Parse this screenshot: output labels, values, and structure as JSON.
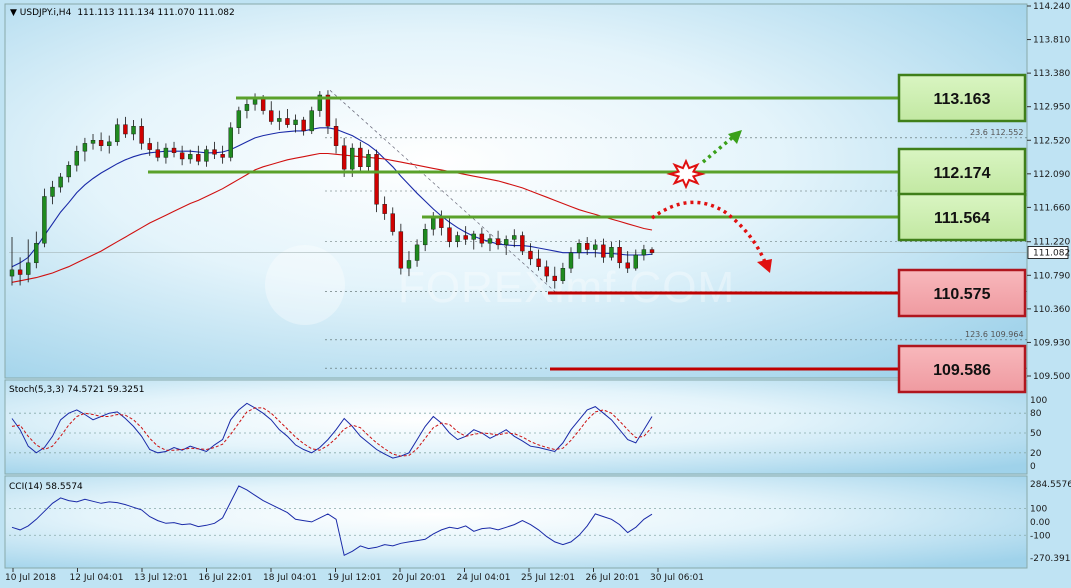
{
  "header": {
    "symbol": "USDJPY.i,H4",
    "ohlc": "111.113 111.134 111.070 111.082"
  },
  "watermark": "FOREXimf.COM",
  "colors": {
    "background": "#bfe3f3",
    "bull_candle": "#1f8a1f",
    "bear_candle": "#d00000",
    "ma_fast": "#1a2aa8",
    "ma_slow": "#d01010",
    "support_line": "#c00000",
    "resistance_line": "#5aa12a",
    "resistance_box": "#cdeeb0",
    "support_box": "#f4a3a8"
  },
  "chart_data": [
    {
      "type": "candlestick",
      "panel": "price",
      "ylim": [
        109.5,
        114.24
      ],
      "y_ticks": [
        "114.240",
        "113.810",
        "113.380",
        "112.950",
        "112.520",
        "112.090",
        "111.660",
        "111.220",
        "110.790",
        "110.360",
        "109.930",
        "109.500"
      ],
      "current_price": "111.082",
      "x_ticks": [
        "10 Jul 2018",
        "12 Jul 04:01",
        "13 Jul 12:01",
        "16 Jul 22:01",
        "18 Jul 04:01",
        "19 Jul 12:01",
        "20 Jul 20:01",
        "24 Jul 04:01",
        "25 Jul 12:01",
        "26 Jul 20:01",
        "30 Jul 06:01"
      ],
      "candles": [
        {
          "o": 110.78,
          "h": 111.28,
          "l": 110.66,
          "c": 110.86
        },
        {
          "o": 110.86,
          "h": 111.02,
          "l": 110.66,
          "c": 110.8
        },
        {
          "o": 110.8,
          "h": 111.25,
          "l": 110.7,
          "c": 110.95
        },
        {
          "o": 110.95,
          "h": 111.35,
          "l": 110.88,
          "c": 111.2
        },
        {
          "o": 111.2,
          "h": 111.9,
          "l": 111.15,
          "c": 111.8
        },
        {
          "o": 111.8,
          "h": 112.0,
          "l": 111.7,
          "c": 111.92
        },
        {
          "o": 111.92,
          "h": 112.1,
          "l": 111.85,
          "c": 112.05
        },
        {
          "o": 112.05,
          "h": 112.25,
          "l": 111.98,
          "c": 112.2
        },
        {
          "o": 112.2,
          "h": 112.45,
          "l": 112.12,
          "c": 112.38
        },
        {
          "o": 112.38,
          "h": 112.55,
          "l": 112.25,
          "c": 112.48
        },
        {
          "o": 112.48,
          "h": 112.6,
          "l": 112.4,
          "c": 112.52
        },
        {
          "o": 112.52,
          "h": 112.62,
          "l": 112.38,
          "c": 112.45
        },
        {
          "o": 112.45,
          "h": 112.58,
          "l": 112.35,
          "c": 112.5
        },
        {
          "o": 112.5,
          "h": 112.8,
          "l": 112.45,
          "c": 112.72
        },
        {
          "o": 112.72,
          "h": 112.82,
          "l": 112.55,
          "c": 112.6
        },
        {
          "o": 112.6,
          "h": 112.78,
          "l": 112.52,
          "c": 112.7
        },
        {
          "o": 112.7,
          "h": 112.8,
          "l": 112.4,
          "c": 112.48
        },
        {
          "o": 112.48,
          "h": 112.55,
          "l": 112.32,
          "c": 112.4
        },
        {
          "o": 112.4,
          "h": 112.5,
          "l": 112.25,
          "c": 112.3
        },
        {
          "o": 112.3,
          "h": 112.48,
          "l": 112.22,
          "c": 112.42
        },
        {
          "o": 112.42,
          "h": 112.5,
          "l": 112.3,
          "c": 112.36
        },
        {
          "o": 112.36,
          "h": 112.45,
          "l": 112.2,
          "c": 112.28
        },
        {
          "o": 112.28,
          "h": 112.4,
          "l": 112.22,
          "c": 112.34
        },
        {
          "o": 112.34,
          "h": 112.45,
          "l": 112.2,
          "c": 112.25
        },
        {
          "o": 112.25,
          "h": 112.45,
          "l": 112.18,
          "c": 112.4
        },
        {
          "o": 112.4,
          "h": 112.5,
          "l": 112.28,
          "c": 112.34
        },
        {
          "o": 112.34,
          "h": 112.45,
          "l": 112.22,
          "c": 112.3
        },
        {
          "o": 112.3,
          "h": 112.75,
          "l": 112.25,
          "c": 112.68
        },
        {
          "o": 112.68,
          "h": 112.95,
          "l": 112.6,
          "c": 112.9
        },
        {
          "o": 112.9,
          "h": 113.05,
          "l": 112.8,
          "c": 112.98
        },
        {
          "o": 112.98,
          "h": 113.12,
          "l": 112.9,
          "c": 113.05
        },
        {
          "o": 113.05,
          "h": 113.1,
          "l": 112.85,
          "c": 112.9
        },
        {
          "o": 112.9,
          "h": 113.02,
          "l": 112.72,
          "c": 112.76
        },
        {
          "o": 112.76,
          "h": 112.9,
          "l": 112.65,
          "c": 112.8
        },
        {
          "o": 112.8,
          "h": 112.92,
          "l": 112.68,
          "c": 112.72
        },
        {
          "o": 112.72,
          "h": 112.85,
          "l": 112.62,
          "c": 112.78
        },
        {
          "o": 112.78,
          "h": 112.82,
          "l": 112.58,
          "c": 112.64
        },
        {
          "o": 112.64,
          "h": 112.95,
          "l": 112.6,
          "c": 112.9
        },
        {
          "o": 112.9,
          "h": 113.15,
          "l": 112.82,
          "c": 113.1
        },
        {
          "o": 113.1,
          "h": 113.16,
          "l": 112.6,
          "c": 112.7
        },
        {
          "o": 112.7,
          "h": 112.8,
          "l": 112.35,
          "c": 112.45
        },
        {
          "o": 112.45,
          "h": 112.55,
          "l": 112.05,
          "c": 112.15
        },
        {
          "o": 112.15,
          "h": 112.48,
          "l": 112.05,
          "c": 112.42
        },
        {
          "o": 112.42,
          "h": 112.5,
          "l": 112.1,
          "c": 112.18
        },
        {
          "o": 112.18,
          "h": 112.4,
          "l": 112.1,
          "c": 112.34
        },
        {
          "o": 112.34,
          "h": 112.4,
          "l": 111.6,
          "c": 111.7
        },
        {
          "o": 111.7,
          "h": 111.8,
          "l": 111.5,
          "c": 111.58
        },
        {
          "o": 111.58,
          "h": 111.66,
          "l": 111.3,
          "c": 111.35
        },
        {
          "o": 111.35,
          "h": 111.45,
          "l": 110.8,
          "c": 110.88
        },
        {
          "o": 110.88,
          "h": 111.1,
          "l": 110.78,
          "c": 110.98
        },
        {
          "o": 110.98,
          "h": 111.25,
          "l": 110.9,
          "c": 111.18
        },
        {
          "o": 111.18,
          "h": 111.45,
          "l": 111.1,
          "c": 111.38
        },
        {
          "o": 111.38,
          "h": 111.6,
          "l": 111.3,
          "c": 111.52
        },
        {
          "o": 111.52,
          "h": 111.62,
          "l": 111.3,
          "c": 111.4
        },
        {
          "o": 111.4,
          "h": 111.52,
          "l": 111.15,
          "c": 111.22
        },
        {
          "o": 111.22,
          "h": 111.35,
          "l": 111.15,
          "c": 111.3
        },
        {
          "o": 111.3,
          "h": 111.42,
          "l": 111.18,
          "c": 111.25
        },
        {
          "o": 111.25,
          "h": 111.36,
          "l": 111.12,
          "c": 111.32
        },
        {
          "o": 111.32,
          "h": 111.4,
          "l": 111.15,
          "c": 111.2
        },
        {
          "o": 111.2,
          "h": 111.32,
          "l": 111.1,
          "c": 111.26
        },
        {
          "o": 111.26,
          "h": 111.36,
          "l": 111.12,
          "c": 111.18
        },
        {
          "o": 111.18,
          "h": 111.3,
          "l": 111.05,
          "c": 111.25
        },
        {
          "o": 111.25,
          "h": 111.38,
          "l": 111.15,
          "c": 111.3
        },
        {
          "o": 111.3,
          "h": 111.35,
          "l": 111.05,
          "c": 111.1
        },
        {
          "o": 111.1,
          "h": 111.2,
          "l": 110.92,
          "c": 111.0
        },
        {
          "o": 111.0,
          "h": 111.12,
          "l": 110.85,
          "c": 110.9
        },
        {
          "o": 110.9,
          "h": 110.98,
          "l": 110.7,
          "c": 110.78
        },
        {
          "o": 110.78,
          "h": 110.9,
          "l": 110.62,
          "c": 110.72
        },
        {
          "o": 110.72,
          "h": 110.95,
          "l": 110.68,
          "c": 110.88
        },
        {
          "o": 110.88,
          "h": 111.15,
          "l": 110.82,
          "c": 111.08
        },
        {
          "o": 111.08,
          "h": 111.25,
          "l": 111.0,
          "c": 111.2
        },
        {
          "o": 111.2,
          "h": 111.28,
          "l": 111.05,
          "c": 111.12
        },
        {
          "o": 111.12,
          "h": 111.25,
          "l": 111.02,
          "c": 111.18
        },
        {
          "o": 111.18,
          "h": 111.26,
          "l": 110.95,
          "c": 111.02
        },
        {
          "o": 111.02,
          "h": 111.22,
          "l": 110.98,
          "c": 111.15
        },
        {
          "o": 111.15,
          "h": 111.24,
          "l": 110.88,
          "c": 110.95
        },
        {
          "o": 110.95,
          "h": 111.1,
          "l": 110.82,
          "c": 110.88
        },
        {
          "o": 110.88,
          "h": 111.12,
          "l": 110.85,
          "c": 111.05
        },
        {
          "o": 111.05,
          "h": 111.18,
          "l": 110.98,
          "c": 111.12
        },
        {
          "o": 111.12,
          "h": 111.15,
          "l": 111.05,
          "c": 111.08
        }
      ],
      "moving_averages": [
        {
          "color": "#1a2aa8",
          "values": [
            110.9,
            110.95,
            111.02,
            111.15,
            111.3,
            111.45,
            111.6,
            111.72,
            111.85,
            111.95,
            112.03,
            112.1,
            112.16,
            112.22,
            112.27,
            112.31,
            112.34,
            112.36,
            112.37,
            112.38,
            112.38,
            112.38,
            112.38,
            112.37,
            112.36,
            112.36,
            112.37,
            112.4,
            112.45,
            112.5,
            112.55,
            112.58,
            112.6,
            112.62,
            112.63,
            112.64,
            112.64,
            112.66,
            112.68,
            112.68,
            112.66,
            112.62,
            112.58,
            112.52,
            112.46,
            112.38,
            112.28,
            112.18,
            112.06,
            111.95,
            111.84,
            111.74,
            111.64,
            111.55,
            111.47,
            111.4,
            111.34,
            111.29,
            111.25,
            111.22,
            111.19,
            111.18,
            111.17,
            111.17,
            111.16,
            111.14,
            111.12,
            111.1,
            111.08,
            111.08,
            111.08,
            111.08,
            111.08,
            111.07,
            111.07,
            111.06,
            111.05,
            111.05,
            111.05,
            111.06
          ]
        },
        {
          "color": "#d01010",
          "values": [
            110.7,
            110.72,
            110.74,
            110.76,
            110.79,
            110.82,
            110.86,
            110.9,
            110.95,
            111.0,
            111.05,
            111.1,
            111.16,
            111.22,
            111.28,
            111.34,
            111.4,
            111.46,
            111.51,
            111.56,
            111.61,
            111.66,
            111.71,
            111.75,
            111.8,
            111.85,
            111.9,
            111.96,
            112.02,
            112.08,
            112.14,
            112.18,
            112.21,
            112.24,
            112.27,
            112.29,
            112.31,
            112.33,
            112.35,
            112.35,
            112.34,
            112.33,
            112.32,
            112.31,
            112.3,
            112.29,
            112.28,
            112.26,
            112.24,
            112.22,
            112.2,
            112.18,
            112.16,
            112.14,
            112.12,
            112.1,
            112.08,
            112.06,
            112.04,
            112.02,
            112.0,
            111.97,
            111.94,
            111.91,
            111.87,
            111.83,
            111.79,
            111.75,
            111.71,
            111.67,
            111.63,
            111.6,
            111.57,
            111.54,
            111.51,
            111.48,
            111.45,
            111.42,
            111.39,
            111.37
          ]
        }
      ],
      "fibonacci_labels": [
        "23.6 112.552",
        "123.6 109.964"
      ],
      "levels": [
        {
          "label": "113.163",
          "kind": "resistance"
        },
        {
          "label": "112.174",
          "kind": "resistance"
        },
        {
          "label": "111.564",
          "kind": "resistance"
        },
        {
          "label": "110.575",
          "kind": "support"
        },
        {
          "label": "109.586",
          "kind": "support"
        }
      ]
    },
    {
      "type": "line",
      "panel": "stochastic",
      "label": "Stoch(5,3,3) 74.5721 59.3251",
      "ylim": [
        0,
        100
      ],
      "y_ticks": [
        "100",
        "80",
        "50",
        "20",
        "0"
      ],
      "series": [
        {
          "color": "#1a2aa8",
          "values": [
            72,
            55,
            30,
            20,
            28,
            45,
            70,
            80,
            85,
            78,
            70,
            75,
            80,
            82,
            72,
            60,
            45,
            25,
            20,
            22,
            28,
            24,
            30,
            26,
            22,
            32,
            40,
            70,
            85,
            95,
            88,
            80,
            70,
            55,
            45,
            32,
            25,
            20,
            28,
            40,
            55,
            72,
            60,
            45,
            35,
            25,
            18,
            12,
            15,
            20,
            40,
            60,
            75,
            65,
            50,
            40,
            45,
            55,
            50,
            42,
            48,
            55,
            45,
            38,
            30,
            28,
            25,
            22,
            35,
            55,
            70,
            85,
            90,
            80,
            70,
            55,
            40,
            35,
            55,
            75
          ]
        },
        {
          "color": "#cc1111",
          "values": [
            60,
            62,
            45,
            32,
            25,
            30,
            45,
            62,
            75,
            80,
            78,
            75,
            75,
            78,
            77,
            70,
            58,
            42,
            30,
            24,
            24,
            25,
            27,
            26,
            25,
            28,
            33,
            48,
            65,
            82,
            88,
            88,
            80,
            68,
            56,
            44,
            34,
            26,
            24,
            31,
            42,
            56,
            62,
            58,
            46,
            35,
            26,
            18,
            15,
            16,
            26,
            42,
            58,
            65,
            63,
            52,
            45,
            48,
            50,
            49,
            47,
            50,
            49,
            44,
            37,
            32,
            28,
            25,
            27,
            39,
            54,
            70,
            82,
            85,
            80,
            68,
            55,
            43,
            45,
            59
          ]
        }
      ]
    },
    {
      "type": "line",
      "panel": "cci",
      "label": "CCI(14) 58.5574",
      "ylim": [
        -270.3915,
        284.5576
      ],
      "y_ticks": [
        "284.5576",
        "100",
        "0.00",
        "-100",
        "-270.3915"
      ],
      "series": [
        {
          "color": "#1a2aa8",
          "values": [
            -40,
            -60,
            -30,
            20,
            80,
            140,
            180,
            160,
            150,
            170,
            155,
            140,
            150,
            145,
            130,
            110,
            90,
            40,
            10,
            -10,
            -5,
            -20,
            -15,
            -35,
            -25,
            -10,
            30,
            150,
            270,
            240,
            200,
            160,
            130,
            100,
            70,
            20,
            10,
            0,
            30,
            60,
            20,
            -250,
            -220,
            -180,
            -200,
            -190,
            -170,
            -180,
            -160,
            -150,
            -140,
            -130,
            -90,
            -60,
            -40,
            -50,
            -30,
            -70,
            -50,
            -45,
            -60,
            -40,
            -20,
            10,
            -20,
            -60,
            -110,
            -150,
            -170,
            -150,
            -100,
            -30,
            60,
            40,
            20,
            -20,
            -80,
            -40,
            20,
            58
          ]
        }
      ]
    }
  ]
}
